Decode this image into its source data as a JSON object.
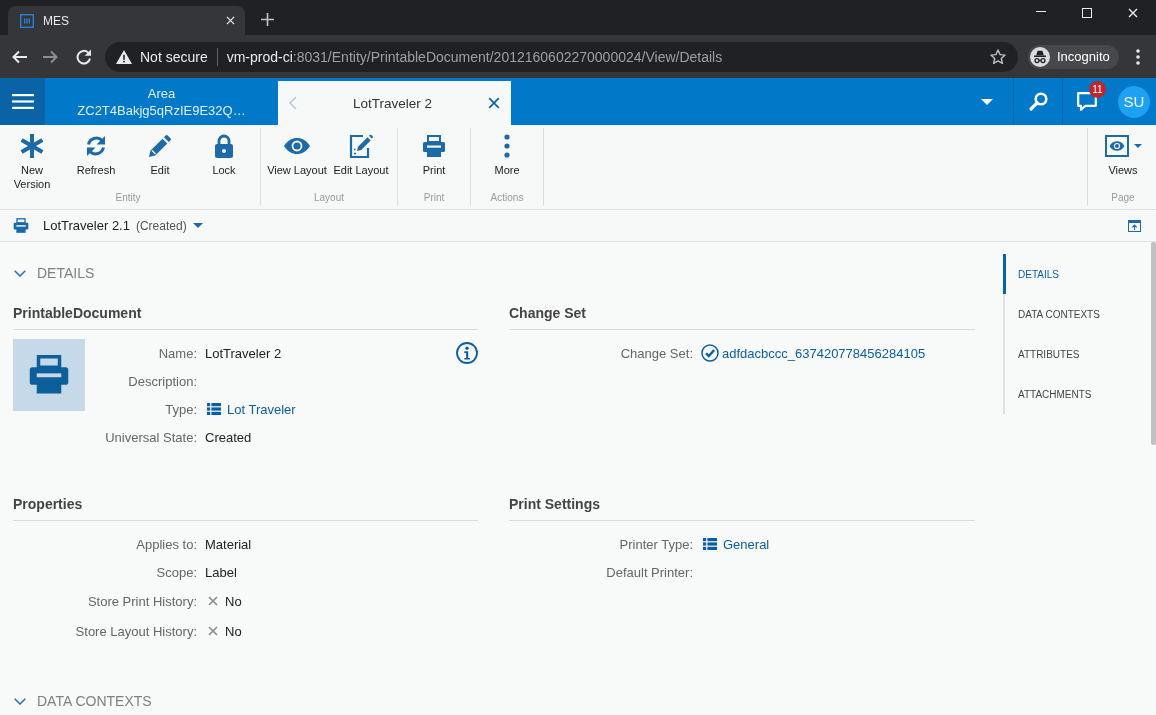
{
  "browser": {
    "tab_title": "MES",
    "security": "Not secure",
    "url_host": "vm-prod-ci",
    "url_path": ":8031/Entity/PrintableDocument/2012160602270000024/View/Details",
    "profile": "Incognito"
  },
  "app_header": {
    "tabs": [
      {
        "kind": "area",
        "label": "Area",
        "subtitle": "ZC2T4Bakjg5qRzIE9E32Q…",
        "selected": false
      },
      {
        "kind": "document",
        "label": "LotTraveler 2",
        "selected": true
      }
    ],
    "notifications": "11",
    "avatar": "SU"
  },
  "toolbar": {
    "groups": [
      {
        "label": "Entity",
        "buttons": [
          {
            "kind": "new",
            "label": "New Version"
          },
          {
            "kind": "refresh",
            "label": "Refresh"
          },
          {
            "kind": "edit",
            "label": "Edit"
          },
          {
            "kind": "lock",
            "label": "Lock"
          }
        ]
      },
      {
        "label": "Layout",
        "buttons": [
          {
            "kind": "view",
            "label": "View Layout"
          },
          {
            "kind": "design",
            "label": "Edit Layout"
          }
        ]
      },
      {
        "label": "Print",
        "buttons": [
          {
            "kind": "print",
            "label": "Print"
          }
        ]
      },
      {
        "label": "Actions",
        "buttons": [
          {
            "kind": "more",
            "label": "More"
          }
        ]
      },
      {
        "label": "Page",
        "buttons": [
          {
            "kind": "views",
            "label": "Views"
          }
        ]
      }
    ]
  },
  "breadcrumb": {
    "title": "LotTraveler 2.1",
    "state": "(Created)"
  },
  "content": {
    "sections": [
      {
        "title": "DETAILS",
        "expanded": true,
        "groups": [
          {
            "kind": "entity",
            "title": "PrintableDocument",
            "fields": [
              {
                "kind": "text",
                "label": "Name:",
                "value": "LotTraveler 2"
              },
              {
                "kind": "text",
                "label": "Description:"
              },
              {
                "kind": "link",
                "label": "Type:",
                "value": "Lot Traveler"
              },
              {
                "kind": "text",
                "label": "Universal State:",
                "value": "Created"
              }
            ]
          },
          {
            "kind": "plain",
            "title": "Change Set",
            "fields": [
              {
                "kind": "changeset",
                "label": "Change Set:",
                "value": "adfdacbccc_637420778456284105"
              }
            ]
          },
          {
            "kind": "plain",
            "title": "Properties",
            "fields": [
              {
                "kind": "text",
                "label": "Applies to:",
                "value": "Material"
              },
              {
                "kind": "text",
                "label": "Scope:",
                "value": "Label"
              },
              {
                "kind": "boolean",
                "label": "Store Print History:",
                "value": "No",
                "checked": false
              },
              {
                "kind": "boolean",
                "label": "Store Layout History:",
                "value": "No",
                "checked": false
              }
            ]
          },
          {
            "kind": "plain",
            "title": "Print Settings",
            "fields": [
              {
                "kind": "link",
                "label": "Printer Type:",
                "value": "General"
              },
              {
                "kind": "text",
                "label": "Default Printer:"
              }
            ]
          }
        ]
      },
      {
        "title": "DATA CONTEXTS",
        "expanded": true
      }
    ]
  },
  "side_nav": {
    "items": [
      {
        "label": "DETAILS",
        "selected": true
      },
      {
        "label": "DATA CONTEXTS",
        "selected": false
      },
      {
        "label": "ATTRIBUTES",
        "selected": false
      },
      {
        "label": "ATTACHMENTS",
        "selected": false
      }
    ]
  }
}
